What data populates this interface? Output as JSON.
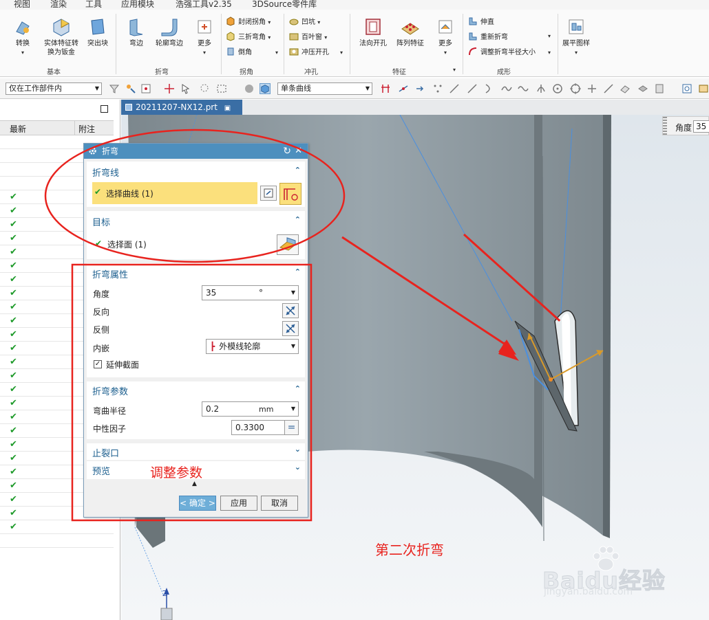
{
  "menu": [
    "视图",
    "渲染",
    "工具",
    "应用模块",
    "浩强工具v2.35",
    "3DSource零件库"
  ],
  "ribbon": {
    "basic": {
      "convert": "转换",
      "solid_to_sheet_l1": "实体特征转",
      "solid_to_sheet_l2": "换为钣金",
      "tab_block": "突出块",
      "group": "基本"
    },
    "bend": {
      "flange": "弯边",
      "contour": "轮廓弯边",
      "more": "更多",
      "group": "折弯"
    },
    "corner": {
      "closed_corner": "封闭拐角",
      "three_bend": "三折弯角",
      "chamfer": "倒角",
      "group": "拐角"
    },
    "punch": {
      "dimple": "凹坑",
      "louver": "百叶窗",
      "punch_hole": "冲压开孔",
      "group": "冲孔"
    },
    "feature": {
      "normal_cutout": "法向开孔",
      "pattern": "阵列特征",
      "more": "更多",
      "group": "特征"
    },
    "form": {
      "unbend": "伸直",
      "rebend": "重新折弯",
      "adjust_radius": "调整折弯半径大小",
      "group": "成形"
    },
    "flat": {
      "flat_pattern": "展平图样"
    }
  },
  "toolbar": {
    "scope_filter": "仅在工作部件内",
    "curve_rule": "单条曲线"
  },
  "left_panel": {
    "col_latest": "最新",
    "col_note": "附注",
    "check_count": 25
  },
  "file_tab": "20211207-NX12.prt",
  "angle_box": {
    "label": "角度",
    "value": "35"
  },
  "dialog": {
    "title": "折弯",
    "bend_line": {
      "header": "折弯线",
      "select_curve": "选择曲线 (1)"
    },
    "target": {
      "header": "目标",
      "select_face": "选择面 (1)"
    },
    "props": {
      "header": "折弯属性",
      "angle_label": "角度",
      "angle_value": "35",
      "angle_unit": "°",
      "reverse": "反向",
      "reverse_side": "反侧",
      "inset_label": "内嵌",
      "inset_value": "外模线轮廓",
      "extend_section": "延伸截面"
    },
    "params": {
      "header": "折弯参数",
      "radius_label": "弯曲半径",
      "radius_value": "0.2",
      "radius_unit": "mm",
      "k_label": "中性因子",
      "k_value": "0.3300",
      "k_eq": "="
    },
    "relief": {
      "header": "止裂口"
    },
    "preview": {
      "header": "预览"
    },
    "buttons": {
      "ok": "< 确定 >",
      "apply": "应用",
      "cancel": "取消"
    }
  },
  "annotations": {
    "adjust": "调整参数",
    "second_bend": "第二次折弯"
  },
  "watermark": {
    "logo": "Baidu经验",
    "url": "jingyan.baidu.com"
  },
  "axis_label": "Z",
  "colors": {
    "accent_red": "#e8231e",
    "title_blue": "#4d8fbe",
    "selection_yellow": "#fbe07c",
    "check_green": "#1e9a2a"
  }
}
